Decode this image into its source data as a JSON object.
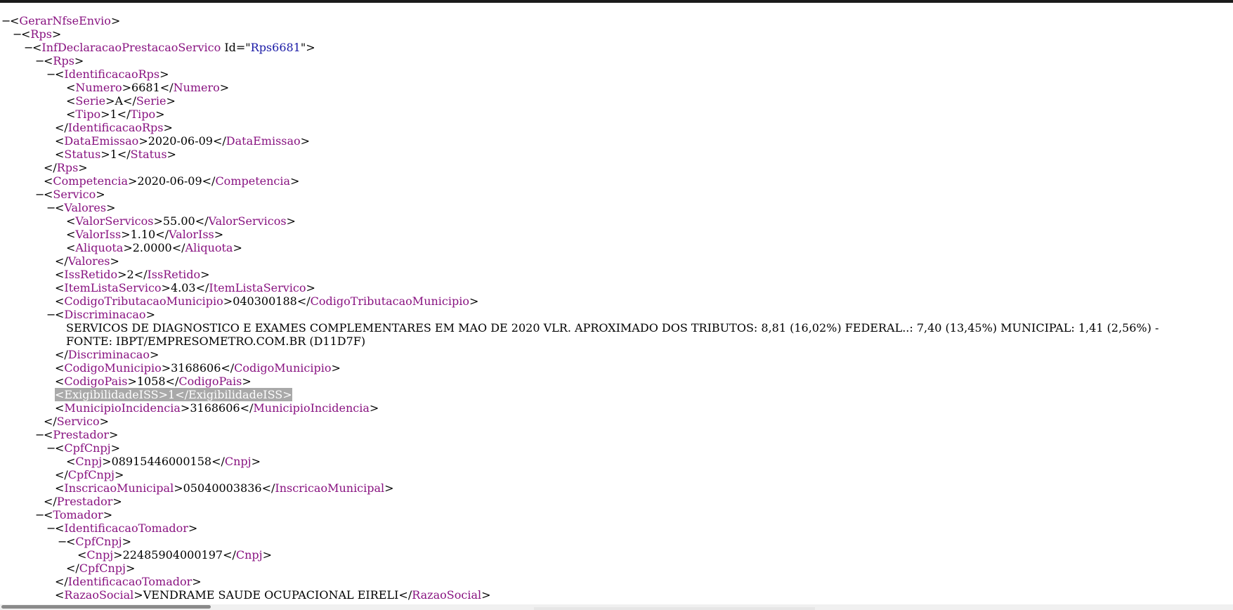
{
  "lines": [
    {
      "indent": 0,
      "toggle": "−",
      "kind": "open",
      "tag": "GerarNfseEnvio"
    },
    {
      "indent": 1,
      "toggle": "−",
      "kind": "open",
      "tag": "Rps"
    },
    {
      "indent": 2,
      "toggle": "−",
      "kind": "open-attr",
      "tag": "InfDeclaracaoPrestacaoServico",
      "attr_name": "Id",
      "attr_value": "Rps6681"
    },
    {
      "indent": 3,
      "toggle": "−",
      "kind": "open",
      "tag": "Rps"
    },
    {
      "indent": 4,
      "toggle": "−",
      "kind": "open",
      "tag": "IdentificacaoRps"
    },
    {
      "indent": 5,
      "toggle": "",
      "kind": "leaf",
      "tag": "Numero",
      "text": "6681"
    },
    {
      "indent": 5,
      "toggle": "",
      "kind": "leaf",
      "tag": "Serie",
      "text": "A"
    },
    {
      "indent": 5,
      "toggle": "",
      "kind": "leaf",
      "tag": "Tipo",
      "text": "1"
    },
    {
      "indent": 4,
      "toggle": "",
      "kind": "close",
      "tag": "IdentificacaoRps"
    },
    {
      "indent": 4,
      "toggle": "",
      "kind": "leaf",
      "tag": "DataEmissao",
      "text": "2020-06-09"
    },
    {
      "indent": 4,
      "toggle": "",
      "kind": "leaf",
      "tag": "Status",
      "text": "1"
    },
    {
      "indent": 3,
      "toggle": "",
      "kind": "close",
      "tag": "Rps"
    },
    {
      "indent": 3,
      "toggle": "",
      "kind": "leaf",
      "tag": "Competencia",
      "text": "2020-06-09"
    },
    {
      "indent": 3,
      "toggle": "−",
      "kind": "open",
      "tag": "Servico"
    },
    {
      "indent": 4,
      "toggle": "−",
      "kind": "open",
      "tag": "Valores"
    },
    {
      "indent": 5,
      "toggle": "",
      "kind": "leaf",
      "tag": "ValorServicos",
      "text": "55.00"
    },
    {
      "indent": 5,
      "toggle": "",
      "kind": "leaf",
      "tag": "ValorIss",
      "text": "1.10"
    },
    {
      "indent": 5,
      "toggle": "",
      "kind": "leaf",
      "tag": "Aliquota",
      "text": "2.0000"
    },
    {
      "indent": 4,
      "toggle": "",
      "kind": "close",
      "tag": "Valores"
    },
    {
      "indent": 4,
      "toggle": "",
      "kind": "leaf",
      "tag": "IssRetido",
      "text": "2"
    },
    {
      "indent": 4,
      "toggle": "",
      "kind": "leaf",
      "tag": "ItemListaServico",
      "text": "4.03"
    },
    {
      "indent": 4,
      "toggle": "",
      "kind": "leaf",
      "tag": "CodigoTributacaoMunicipio",
      "text": "040300188"
    },
    {
      "indent": 4,
      "toggle": "−",
      "kind": "open",
      "tag": "Discriminacao"
    },
    {
      "indent": 5,
      "toggle": "",
      "kind": "text",
      "text": "SERVICOS DE DIAGNOSTICO E EXAMES COMPLEMENTARES EM MAO DE 2020 VLR. APROXIMADO DOS TRIBUTOS: 8,81 (16,02%) FEDERAL..: 7,40 (13,45%) MUNICIPAL: 1,41 (2,56%) - FONTE: IBPT/EMPRESOMETRO.COM.BR (D11D7F)"
    },
    {
      "indent": 4,
      "toggle": "",
      "kind": "close",
      "tag": "Discriminacao"
    },
    {
      "indent": 4,
      "toggle": "",
      "kind": "leaf",
      "tag": "CodigoMunicipio",
      "text": "3168606"
    },
    {
      "indent": 4,
      "toggle": "",
      "kind": "leaf",
      "tag": "CodigoPais",
      "text": "1058"
    },
    {
      "indent": 4,
      "toggle": "",
      "kind": "leaf",
      "tag": "ExigibilidadeISS",
      "text": "1",
      "highlight": true
    },
    {
      "indent": 4,
      "toggle": "",
      "kind": "leaf",
      "tag": "MunicipioIncidencia",
      "text": "3168606"
    },
    {
      "indent": 3,
      "toggle": "",
      "kind": "close",
      "tag": "Servico"
    },
    {
      "indent": 3,
      "toggle": "−",
      "kind": "open",
      "tag": "Prestador"
    },
    {
      "indent": 4,
      "toggle": "−",
      "kind": "open",
      "tag": "CpfCnpj"
    },
    {
      "indent": 5,
      "toggle": "",
      "kind": "leaf",
      "tag": "Cnpj",
      "text": "08915446000158"
    },
    {
      "indent": 4,
      "toggle": "",
      "kind": "close",
      "tag": "CpfCnpj"
    },
    {
      "indent": 4,
      "toggle": "",
      "kind": "leaf",
      "tag": "InscricaoMunicipal",
      "text": "05040003836"
    },
    {
      "indent": 3,
      "toggle": "",
      "kind": "close",
      "tag": "Prestador"
    },
    {
      "indent": 3,
      "toggle": "−",
      "kind": "open",
      "tag": "Tomador"
    },
    {
      "indent": 4,
      "toggle": "−",
      "kind": "open",
      "tag": "IdentificacaoTomador"
    },
    {
      "indent": 5,
      "toggle": "−",
      "kind": "open",
      "tag": "CpfCnpj"
    },
    {
      "indent": 6,
      "toggle": "",
      "kind": "leaf",
      "tag": "Cnpj",
      "text": "22485904000197"
    },
    {
      "indent": 5,
      "toggle": "",
      "kind": "close",
      "tag": "CpfCnpj"
    },
    {
      "indent": 4,
      "toggle": "",
      "kind": "close",
      "tag": "IdentificacaoTomador"
    },
    {
      "indent": 4,
      "toggle": "",
      "kind": "leaf",
      "tag": "RazaoSocial",
      "text": "VENDRAME SAUDE OCUPACIONAL EIRELI"
    }
  ]
}
